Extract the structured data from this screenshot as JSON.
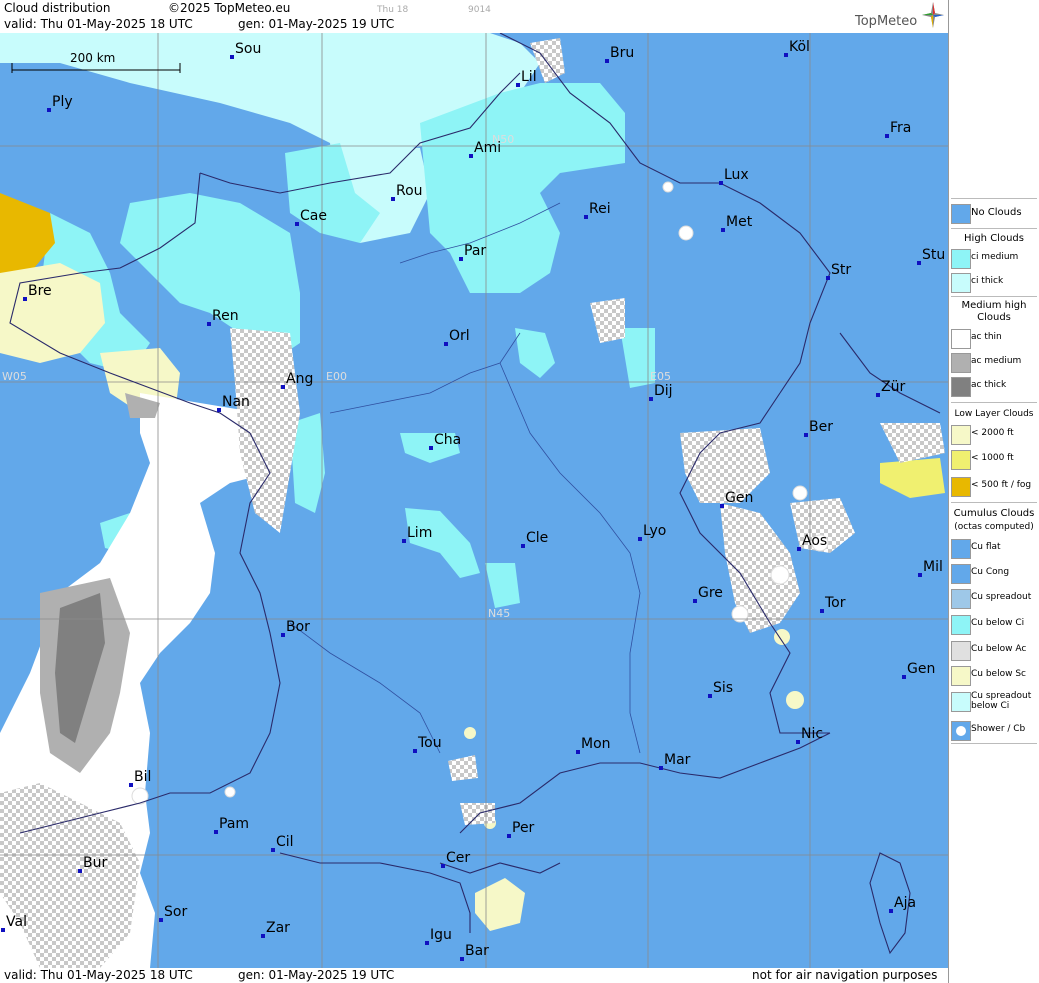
{
  "header": {
    "title": "Cloud distribution",
    "copyright": "©2025 TopMeteo.eu",
    "valid": "valid:  Thu  01-May-2025  18 UTC",
    "gen": "gen: 01-May-2025 19 UTC",
    "faint_day": "Thu 18",
    "faint_code": "9014",
    "logo": "TopMeteo"
  },
  "footer": {
    "valid": "valid:  Thu  01-May-2025  18 UTC",
    "gen": "gen: 01-May-2025 19 UTC",
    "notice": "not for air navigation purposes"
  },
  "map": {
    "scale_label": "200 km",
    "grid_labels": {
      "n50": "N50",
      "n45": "N45",
      "w05": "W05",
      "e00": "E00",
      "e05": "E05"
    },
    "cities": [
      {
        "name": "Sou"
      },
      {
        "name": "Bru"
      },
      {
        "name": "Köl"
      },
      {
        "name": "Lil"
      },
      {
        "name": "Ply"
      },
      {
        "name": "Ami"
      },
      {
        "name": "Fra"
      },
      {
        "name": "Lux"
      },
      {
        "name": "Rou"
      },
      {
        "name": "Cae"
      },
      {
        "name": "Rei"
      },
      {
        "name": "Met"
      },
      {
        "name": "Par"
      },
      {
        "name": "Stu"
      },
      {
        "name": "Bre"
      },
      {
        "name": "Str"
      },
      {
        "name": "Ren"
      },
      {
        "name": "Orl"
      },
      {
        "name": "Ang"
      },
      {
        "name": "Dij"
      },
      {
        "name": "Zür"
      },
      {
        "name": "Nan"
      },
      {
        "name": "Ber"
      },
      {
        "name": "Cha"
      },
      {
        "name": "Gen"
      },
      {
        "name": "Lim"
      },
      {
        "name": "Cle"
      },
      {
        "name": "Lyo"
      },
      {
        "name": "Aos"
      },
      {
        "name": "Mil"
      },
      {
        "name": "Gre"
      },
      {
        "name": "Tor"
      },
      {
        "name": "Bor"
      },
      {
        "name": "Sis"
      },
      {
        "name": "Gen"
      },
      {
        "name": "Nic"
      },
      {
        "name": "Tou"
      },
      {
        "name": "Mon"
      },
      {
        "name": "Mar"
      },
      {
        "name": "Bil"
      },
      {
        "name": "Pam"
      },
      {
        "name": "Cil"
      },
      {
        "name": "Per"
      },
      {
        "name": "Cer"
      },
      {
        "name": "Bur"
      },
      {
        "name": "Aja"
      },
      {
        "name": "Sor"
      },
      {
        "name": "Val"
      },
      {
        "name": "Zar"
      },
      {
        "name": "Igu"
      },
      {
        "name": "Bar"
      }
    ]
  },
  "legend": {
    "no_clouds": "No Clouds",
    "high_header": "High Clouds",
    "ci_medium": "ci medium",
    "ci_thick": "ci thick",
    "medium_header": "Medium high Clouds",
    "ac_thin": "ac thin",
    "ac_medium": "ac medium",
    "ac_thick": "ac thick",
    "low_header": "Low Layer Clouds",
    "low_2000": "< 2000 ft",
    "low_1000": "< 1000 ft",
    "low_500": "< 500 ft / fog",
    "cumulus_header": "Cumulus Clouds",
    "cumulus_sub": "(octas computed)",
    "cu_flat": "Cu flat",
    "cu_cong": "Cu Cong",
    "cu_spreadout": "Cu spreadout",
    "cu_below_ci": "Cu below Ci",
    "cu_below_ac": "Cu below Ac",
    "cu_below_sc": "Cu below Sc",
    "cu_spreadout_below_ci": "Cu spreadout below Ci",
    "shower_cb": "Shower / Cb",
    "colors": {
      "no_clouds": "#62a8ea",
      "ci_medium": "#8ef4f6",
      "ci_thick": "#c8fcfc",
      "ac_thin": "#ffffff",
      "ac_medium": "#b0b0b0",
      "ac_thick": "#808080",
      "low_2000": "#f6f8c8",
      "low_1000": "#f0f070",
      "low_500": "#e8b800"
    }
  }
}
